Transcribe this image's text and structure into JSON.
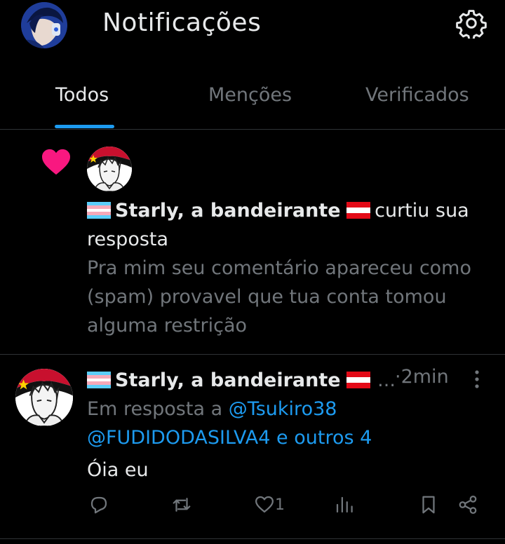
{
  "header": {
    "title": "Notificações",
    "avatar_icon": "user-avatar",
    "settings_icon": "gear-icon"
  },
  "tabs": [
    {
      "label": "Todos",
      "active": true
    },
    {
      "label": "Menções",
      "active": false
    },
    {
      "label": "Verificados",
      "active": false
    }
  ],
  "notification": {
    "icon": "heart-icon",
    "user_name": "Starly, a bandeirante",
    "action_text": "curtiu sua",
    "action_text_cont": "resposta",
    "quoted_lines": [
      "Pra mim seu comentário apareceu como",
      "(spam) provavel que tua conta tomou",
      "alguma restrição"
    ]
  },
  "post": {
    "user_name": "Starly, a bandeirante",
    "ellipsis": "...",
    "time": "·2min",
    "reply_prefix": "Em resposta a",
    "reply_user1": "@Tsukiro38",
    "reply_user2": "@FUDIDODASILVA4",
    "reply_others": "e outros 4",
    "text": "Óia eu",
    "likes": "1"
  },
  "colors": {
    "accent": "#1d9bf0",
    "like": "#f91880",
    "muted": "#71767b",
    "text": "#e7e9ea",
    "bg": "#000000"
  }
}
